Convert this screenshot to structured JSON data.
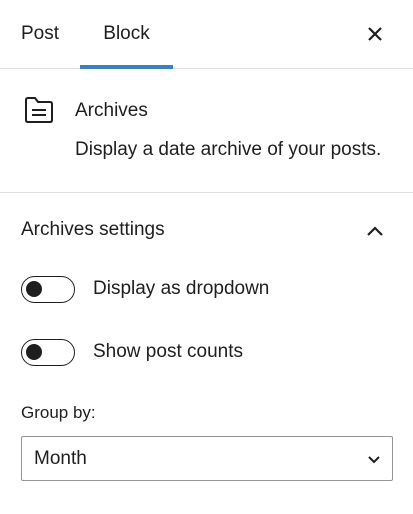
{
  "tabs": [
    {
      "label": "Post"
    },
    {
      "label": "Block",
      "active": true
    }
  ],
  "header": {
    "close_icon": "close-icon"
  },
  "block": {
    "icon": "archive-folder-icon",
    "title": "Archives",
    "description": "Display a date archive of your posts."
  },
  "settings": {
    "title": "Archives settings",
    "expanded": true,
    "toggles": [
      {
        "label": "Display as dropdown",
        "checked": false
      },
      {
        "label": "Show post counts",
        "checked": false
      }
    ],
    "group_by": {
      "label": "Group by:",
      "value": "Month"
    }
  },
  "colors": {
    "accent": "#3582c4",
    "text": "#1e1e1e",
    "border": "#e0e0e0"
  }
}
